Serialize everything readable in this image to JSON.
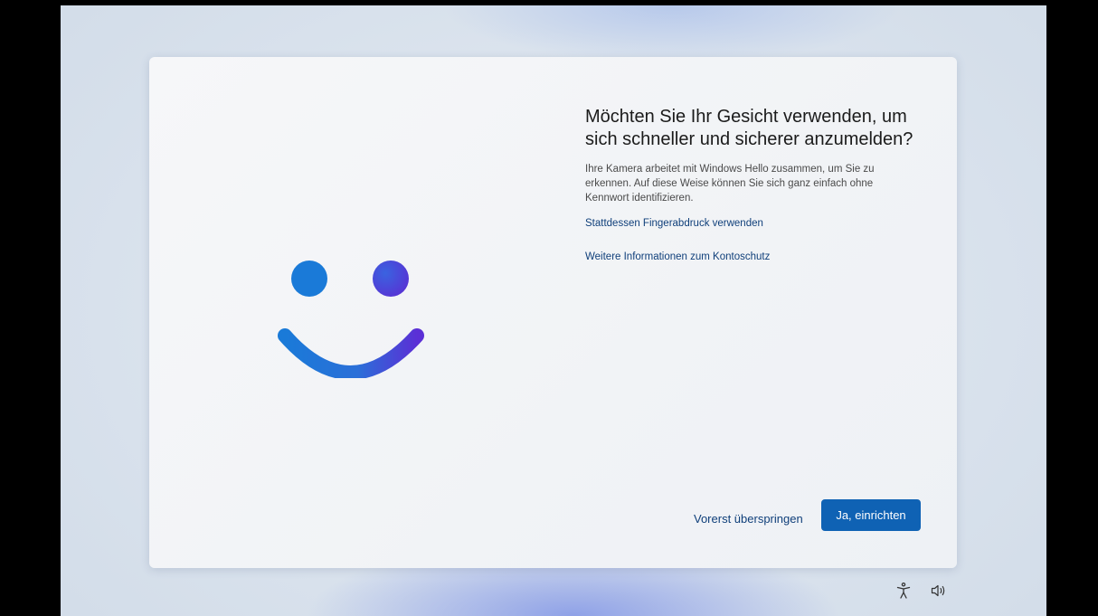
{
  "dialog": {
    "title": "Möchten Sie Ihr Gesicht verwenden, um sich schneller und sicherer anzumelden?",
    "description": "Ihre Kamera arbeitet mit Windows Hello zusammen, um Sie zu erkennen. Auf diese Weise können Sie sich ganz einfach ohne Kennwort identifizieren.",
    "link_fingerprint": "Stattdessen Fingerabdruck verwenden",
    "link_more_info": "Weitere Informationen zum Kontoschutz",
    "skip_label": "Vorerst überspringen",
    "primary_label": "Ja, einrichten"
  },
  "illustration": {
    "icon": "windows-hello-face-icon"
  },
  "tray": {
    "icons": [
      "accessibility-icon",
      "volume-icon"
    ]
  },
  "colors": {
    "accent": "#0f62b4",
    "link": "#0f3f7a",
    "smile_start": "#1a7ad8",
    "smile_end": "#5b2fd6"
  }
}
